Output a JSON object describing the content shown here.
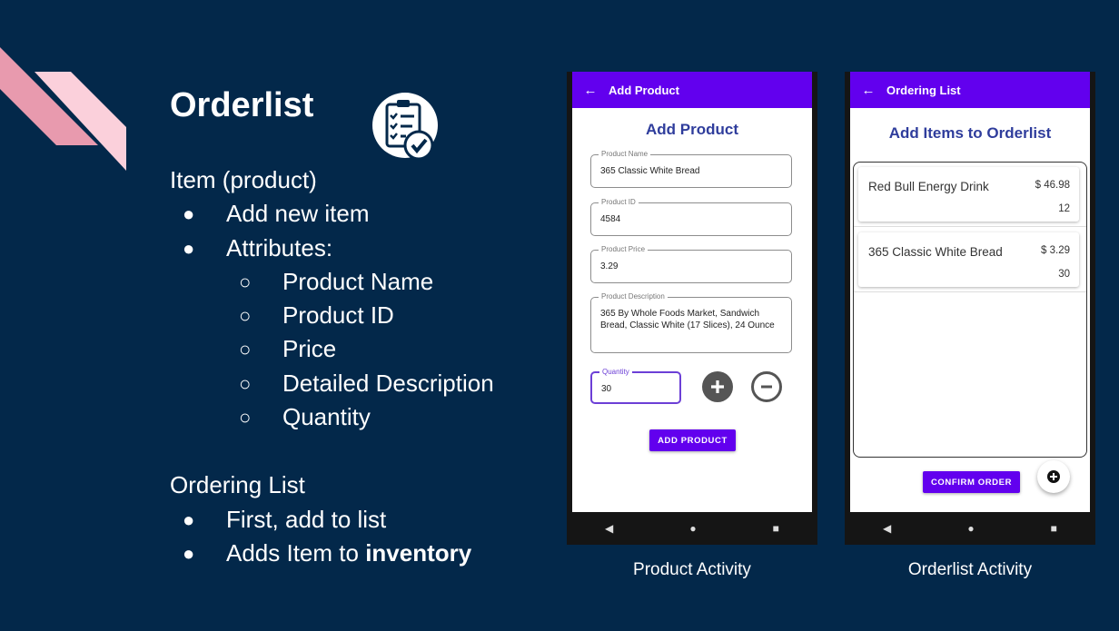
{
  "slide": {
    "title": "Orderlist",
    "lines": [
      {
        "text": "Item (product)",
        "level": 0
      },
      {
        "text": "Add new item",
        "level": 1
      },
      {
        "text": "Attributes:",
        "level": 1
      },
      {
        "text": "Product Name",
        "level": 2
      },
      {
        "text": "Product ID",
        "level": 2
      },
      {
        "text": "Price",
        "level": 2
      },
      {
        "text": "Detailed Description",
        "level": 2
      },
      {
        "text": "Quantity",
        "level": 2
      },
      {
        "text": "Ordering List",
        "level": 0
      },
      {
        "text": "First, add to list",
        "level": 1
      },
      {
        "text": "Adds Item to ",
        "bold": "inventory",
        "level": 1
      }
    ]
  },
  "colors": {
    "background": "#03284a",
    "accent": "#6200ee",
    "heading": "#2f3d9c",
    "decoration": "#e89aae"
  },
  "product_screen": {
    "caption": "Product Activity",
    "appbar_title": "Add Product",
    "heading": "Add Product",
    "fields": [
      {
        "label": "Product Name",
        "value": "365 Classic White Bread"
      },
      {
        "label": "Product ID",
        "value": "4584"
      },
      {
        "label": "Product Price",
        "value": "3.29"
      },
      {
        "label": "Product Description",
        "value": "365 By Whole Foods Market, Sandwich Bread, Classic White (17 Slices), 24 Ounce"
      },
      {
        "label": "Quantity",
        "value": "30"
      }
    ],
    "add_icon": "plus-circle-icon",
    "remove_icon": "minus-circle-icon",
    "add_button": "ADD PRODUCT"
  },
  "orderlist_screen": {
    "caption": "Orderlist Activity",
    "appbar_title": "Ordering List",
    "heading": "Add Items to Orderlist",
    "items": [
      {
        "name": "Red Bull Energy Drink",
        "price": "$ 46.98",
        "qty": "12"
      },
      {
        "name": "365 Classic White Bread",
        "price": "$ 3.29",
        "qty": "30"
      }
    ],
    "confirm_button": "CONFIRM ORDER",
    "fab_icon": "plus-circle-icon"
  },
  "nav_icons": [
    "back-triangle-icon",
    "home-circle-icon",
    "recents-square-icon"
  ]
}
